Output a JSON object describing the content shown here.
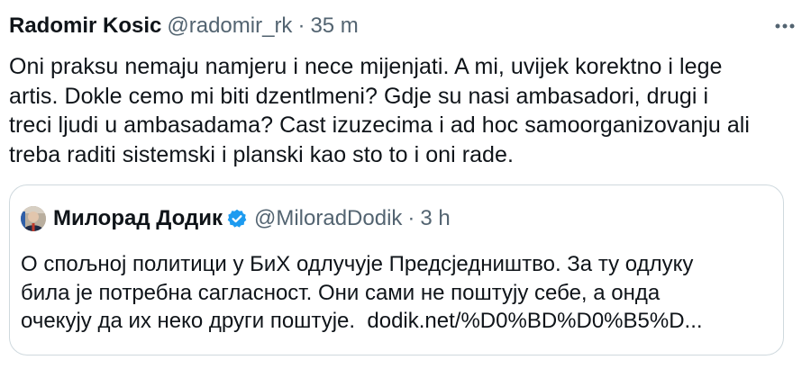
{
  "tweet": {
    "author_name": "Radomir Kosic",
    "author_handle": "@radomir_rk",
    "separator": "·",
    "time": "35 m",
    "text_lines": [
      "Oni praksu nemaju namjeru i nece mijenjati. A mi, uvijek korektno i lege",
      "artis. Dokle cemo mi biti dzentlmeni? Gdje su nasi ambasadori, drugi i",
      "treci ljudi u ambasadama? Cast izuzecima i ad hoc samoorganizovanju ali",
      "treba raditi sistemski i planski kao sto to i oni rade."
    ]
  },
  "quote": {
    "author_name": "Милорад Додик",
    "verified": true,
    "author_handle": "@MiloradDodik",
    "separator": "·",
    "time": "3 h",
    "text_lines": [
      "О спољној политици у БиХ одлучује Предсједништво. За ту одлуку",
      "била је потребна сагласност. Они сами не поштују себе, а онда"
    ],
    "text_line3": "очекују да их неко други поштује.",
    "link": "dodik.net/%D0%BD%D0%B5%D..."
  },
  "colors": {
    "text": "#0f1419",
    "secondary": "#536471",
    "verified": "#1d9bf0",
    "border": "#cfd9de"
  },
  "icons": {
    "more": "more-dots-icon",
    "verified": "verified-badge-icon"
  }
}
